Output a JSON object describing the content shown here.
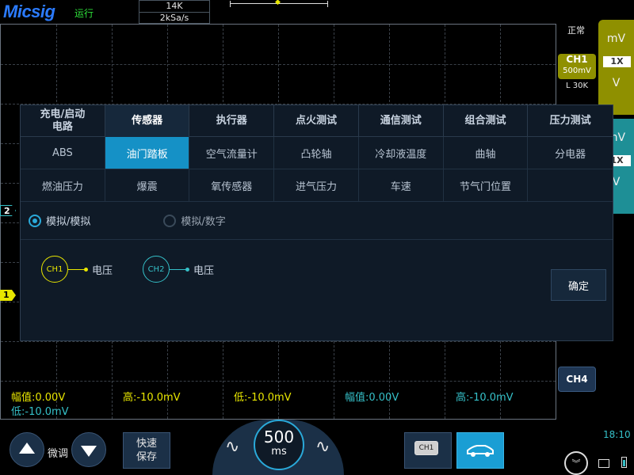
{
  "header": {
    "logo": "Micsig",
    "run_status": "运行",
    "memory_depth": "14K",
    "sample_rate": "2kSa/s"
  },
  "right_panel": {
    "trigger_mode": "正常",
    "ch1": {
      "name": "CH1",
      "scale": "500mV",
      "bandwidth": "L 30K",
      "unit": "mV",
      "probe": "1X",
      "coupling": "V"
    },
    "ch2": {
      "unit": "mV",
      "probe": "1X",
      "coupling": "V"
    },
    "ch4_button": "CH4"
  },
  "channel_markers": {
    "ch1": "1",
    "ch2": "2"
  },
  "dialog": {
    "tabs": [
      "充电/启动\n电路",
      "传感器",
      "执行器",
      "点火测试",
      "通信测试",
      "组合测试",
      "压力测试"
    ],
    "active_tab": 1,
    "sensors_row1": [
      "ABS",
      "油门踏板",
      "空气流量计",
      "凸轮轴",
      "冷却液温度",
      "曲轴",
      "分电器"
    ],
    "sensors_row2": [
      "燃油压力",
      "爆震",
      "氧传感器",
      "进气压力",
      "车速",
      "节气门位置",
      ""
    ],
    "active_sensor": "油门踏板",
    "radio_options": [
      "模拟/模拟",
      "模拟/数字"
    ],
    "radio_selected": 0,
    "probes": [
      {
        "channel": "CH1",
        "label": "电压"
      },
      {
        "channel": "CH2",
        "label": "电压"
      }
    ],
    "confirm_label": "确定"
  },
  "measurements": {
    "ch1_amplitude": "幅值:0.00V",
    "ch1_high": "高:-10.0mV",
    "ch1_low": "低:-10.0mV",
    "ch2_amplitude": "幅值:0.00V",
    "ch2_high": "高:-10.0mV",
    "ch2_low": "低:-10.0mV"
  },
  "bottom": {
    "fine_adjust": "微调",
    "quick_save": "快速\n保存",
    "timebase_value": "500",
    "timebase_unit": "ms",
    "ch1_stack_label": "CH1",
    "time": "18:10"
  },
  "colors": {
    "ch1": "#e8e600",
    "ch2": "#35c0c8",
    "accent": "#1591c6"
  }
}
